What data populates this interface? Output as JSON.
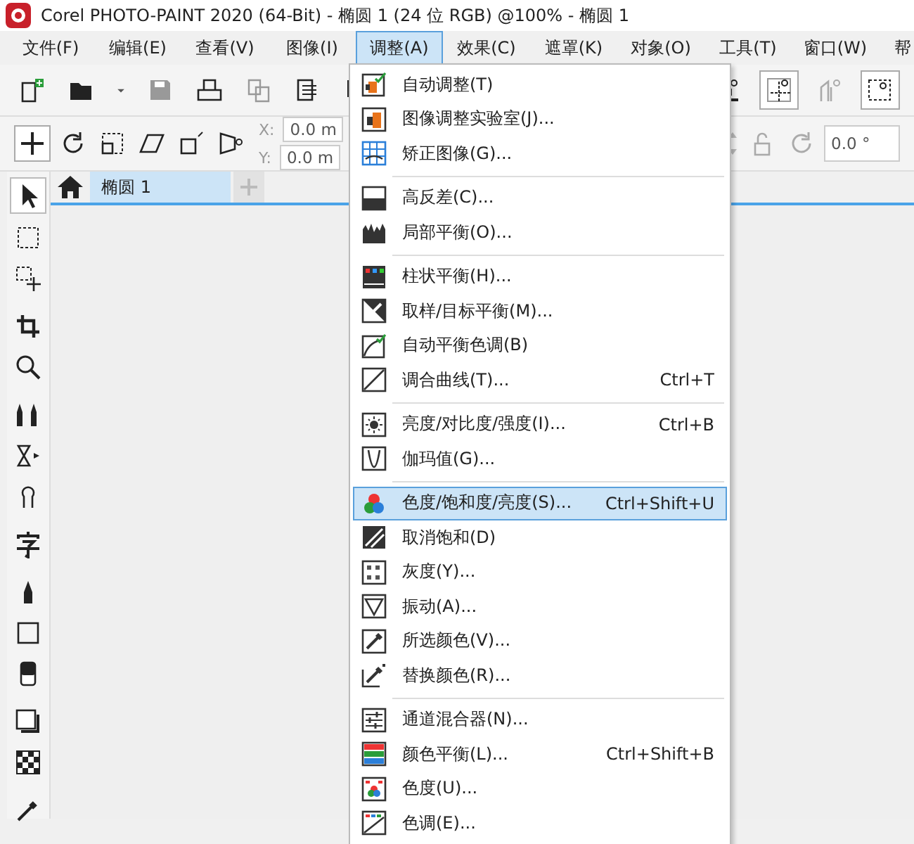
{
  "window": {
    "title": "Corel PHOTO-PAINT 2020 (64-Bit) - 椭圆 1 (24 位 RGB) @100% - 椭圆 1"
  },
  "menubar": [
    {
      "label": "文件(F)",
      "selected": false
    },
    {
      "label": "编辑(E)",
      "selected": false
    },
    {
      "label": "查看(V)",
      "selected": false
    },
    {
      "label": "图像(I)",
      "selected": false
    },
    {
      "label": "调整(A)",
      "selected": true
    },
    {
      "label": "效果(C)",
      "selected": false
    },
    {
      "label": "遮罩(K)",
      "selected": false
    },
    {
      "label": "对象(O)",
      "selected": false
    },
    {
      "label": "工具(T)",
      "selected": false
    },
    {
      "label": "窗口(W)",
      "selected": false
    },
    {
      "label": "帮",
      "selected": false
    }
  ],
  "property_bar": {
    "x_label": "X:",
    "x_value": "0.0 m",
    "y_label": "Y:",
    "y_value": "0.0 m",
    "angle_value": "0.0 °"
  },
  "tabs": [
    {
      "label": "椭圆 1",
      "selected": true
    }
  ],
  "menu": {
    "groups": [
      [
        {
          "label": "自动调整(T)",
          "selected": false
        },
        {
          "label": "图像调整实验室(J)...",
          "selected": false
        },
        {
          "label": "矫正图像(G)...",
          "selected": false
        }
      ],
      [
        {
          "label": "高反差(C)...",
          "selected": false
        },
        {
          "label": "局部平衡(O)...",
          "selected": false
        }
      ],
      [
        {
          "label": "柱状平衡(H)...",
          "selected": false
        },
        {
          "label": "取样/目标平衡(M)...",
          "selected": false
        },
        {
          "label": "自动平衡色调(B)",
          "selected": false
        },
        {
          "label": "调合曲线(T)...",
          "shortcut": "Ctrl+T",
          "selected": false
        }
      ],
      [
        {
          "label": "亮度/对比度/强度(I)...",
          "shortcut": "Ctrl+B",
          "selected": false
        },
        {
          "label": "伽玛值(G)...",
          "selected": false
        }
      ],
      [
        {
          "label": "色度/饱和度/亮度(S)...",
          "shortcut": "Ctrl+Shift+U",
          "selected": true
        },
        {
          "label": "取消饱和(D)",
          "selected": false
        },
        {
          "label": "灰度(Y)...",
          "selected": false
        },
        {
          "label": "振动(A)...",
          "selected": false
        },
        {
          "label": "所选颜色(V)...",
          "selected": false
        },
        {
          "label": "替换颜色(R)...",
          "selected": false
        }
      ],
      [
        {
          "label": "通道混合器(N)...",
          "selected": false
        },
        {
          "label": "颜色平衡(L)...",
          "shortcut": "Ctrl+Shift+B",
          "selected": false
        },
        {
          "label": "色度(U)...",
          "selected": false
        },
        {
          "label": "色调(E)...",
          "selected": false
        }
      ]
    ]
  }
}
